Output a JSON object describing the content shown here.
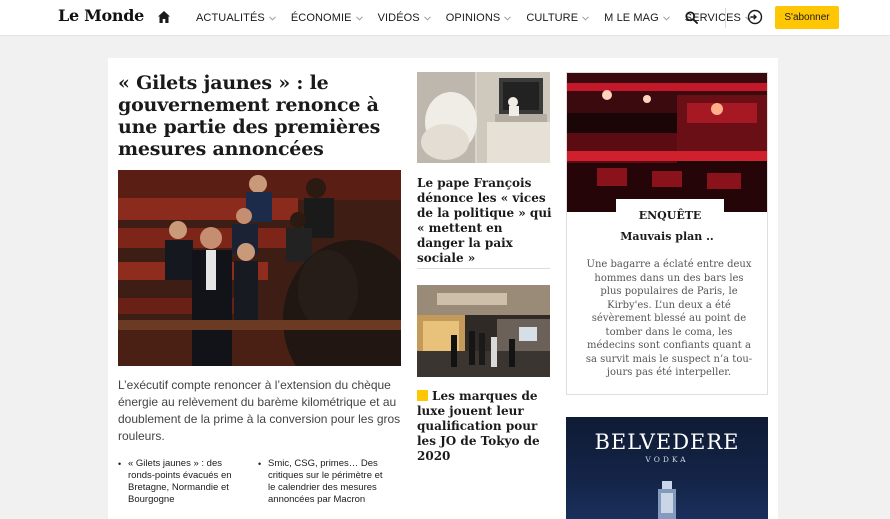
{
  "header": {
    "logo": "Le Monde",
    "nav": [
      {
        "label": "ACTUALITÉS",
        "has_dropdown": true
      },
      {
        "label": "ÉCONOMIE",
        "has_dropdown": true
      },
      {
        "label": "VIDÉOS",
        "has_dropdown": true
      },
      {
        "label": "OPINIONS",
        "has_dropdown": true
      },
      {
        "label": "CULTURE",
        "has_dropdown": true
      },
      {
        "label": "M LE MAG",
        "has_dropdown": true
      },
      {
        "label": "SERVICES",
        "has_dropdown": true
      }
    ],
    "subscribe_label": "S'abonner",
    "icons": {
      "home": "home-icon",
      "search": "search-icon",
      "login": "login-icon",
      "dropdown": "chevron-down-icon"
    },
    "colors": {
      "subscribe_bg": "#ffc603",
      "background": "#ffffff"
    }
  },
  "main": {
    "headline": "« Gilets jaunes » : le gouvernement renonce à une partie des premières mesures annoncées",
    "description": "L’exécutif compte renoncer à l’extension du chèque énergie au relèvement du barème kilométrique et au doublement de la prime à la conversion pour les gros rouleurs.",
    "related": [
      {
        "bullet": "•",
        "text": "« Gilets jaunes » : des ronds-points évacués en Bretagne, Normandie et Bourgogne"
      },
      {
        "bullet": "•",
        "text": "Smic, CSG, primes… Des critiques sur le périmètre et le calendrier des mesures annoncées par Macron"
      }
    ]
  },
  "column2": {
    "articles": [
      {
        "title": "Le pape François dénonce les « vices de la politique » qui « mettent en danger la paix sociale »"
      },
      {
        "title": "Les marques de luxe jouent leur qualification pour les JO de Tokyo de 2020",
        "badge_color": "#ffc603"
      }
    ]
  },
  "column3": {
    "kicker": "ENQUÊTE",
    "title": "Mauvais plan ..",
    "text": "Une bagarre a éclaté entre deux hommes dans un des bars les plus populaires de Paris, le Kirby'es. L’un deux a été sévèrement blessé au point de tomber dans le coma, les médecins sont confiants quant a sa survit mais le suspect n’a tou-jours pas été interpeller."
  },
  "ad": {
    "brand": "BELVEDERE",
    "sub": "VODKA"
  }
}
